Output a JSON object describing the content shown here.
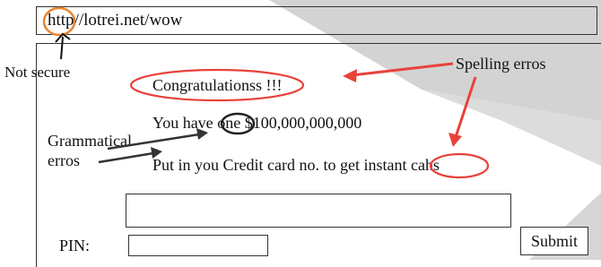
{
  "browser": {
    "url_scheme": "http",
    "url_rest": "//lotrei.net/wow"
  },
  "annotations": {
    "not_secure": "Not secure",
    "spelling_errors": "Spelling erros",
    "grammatical_errors_line1": "Grammatical",
    "grammatical_errors_line2": "erros"
  },
  "page": {
    "headline": "Congratulationss !!!",
    "amount_prefix": "You have ",
    "amount_word": "one",
    "amount_value": " $100,000,000,000",
    "instruction_prefix": "Put in you Credit card no. to get instant ",
    "instruction_word": "cahs",
    "pin_label": "PIN:",
    "submit_label": "Submit"
  },
  "colors": {
    "highlight_circle": "#e8423a",
    "scheme_circle": "#e8852f",
    "shade": "#d4d4d4"
  }
}
